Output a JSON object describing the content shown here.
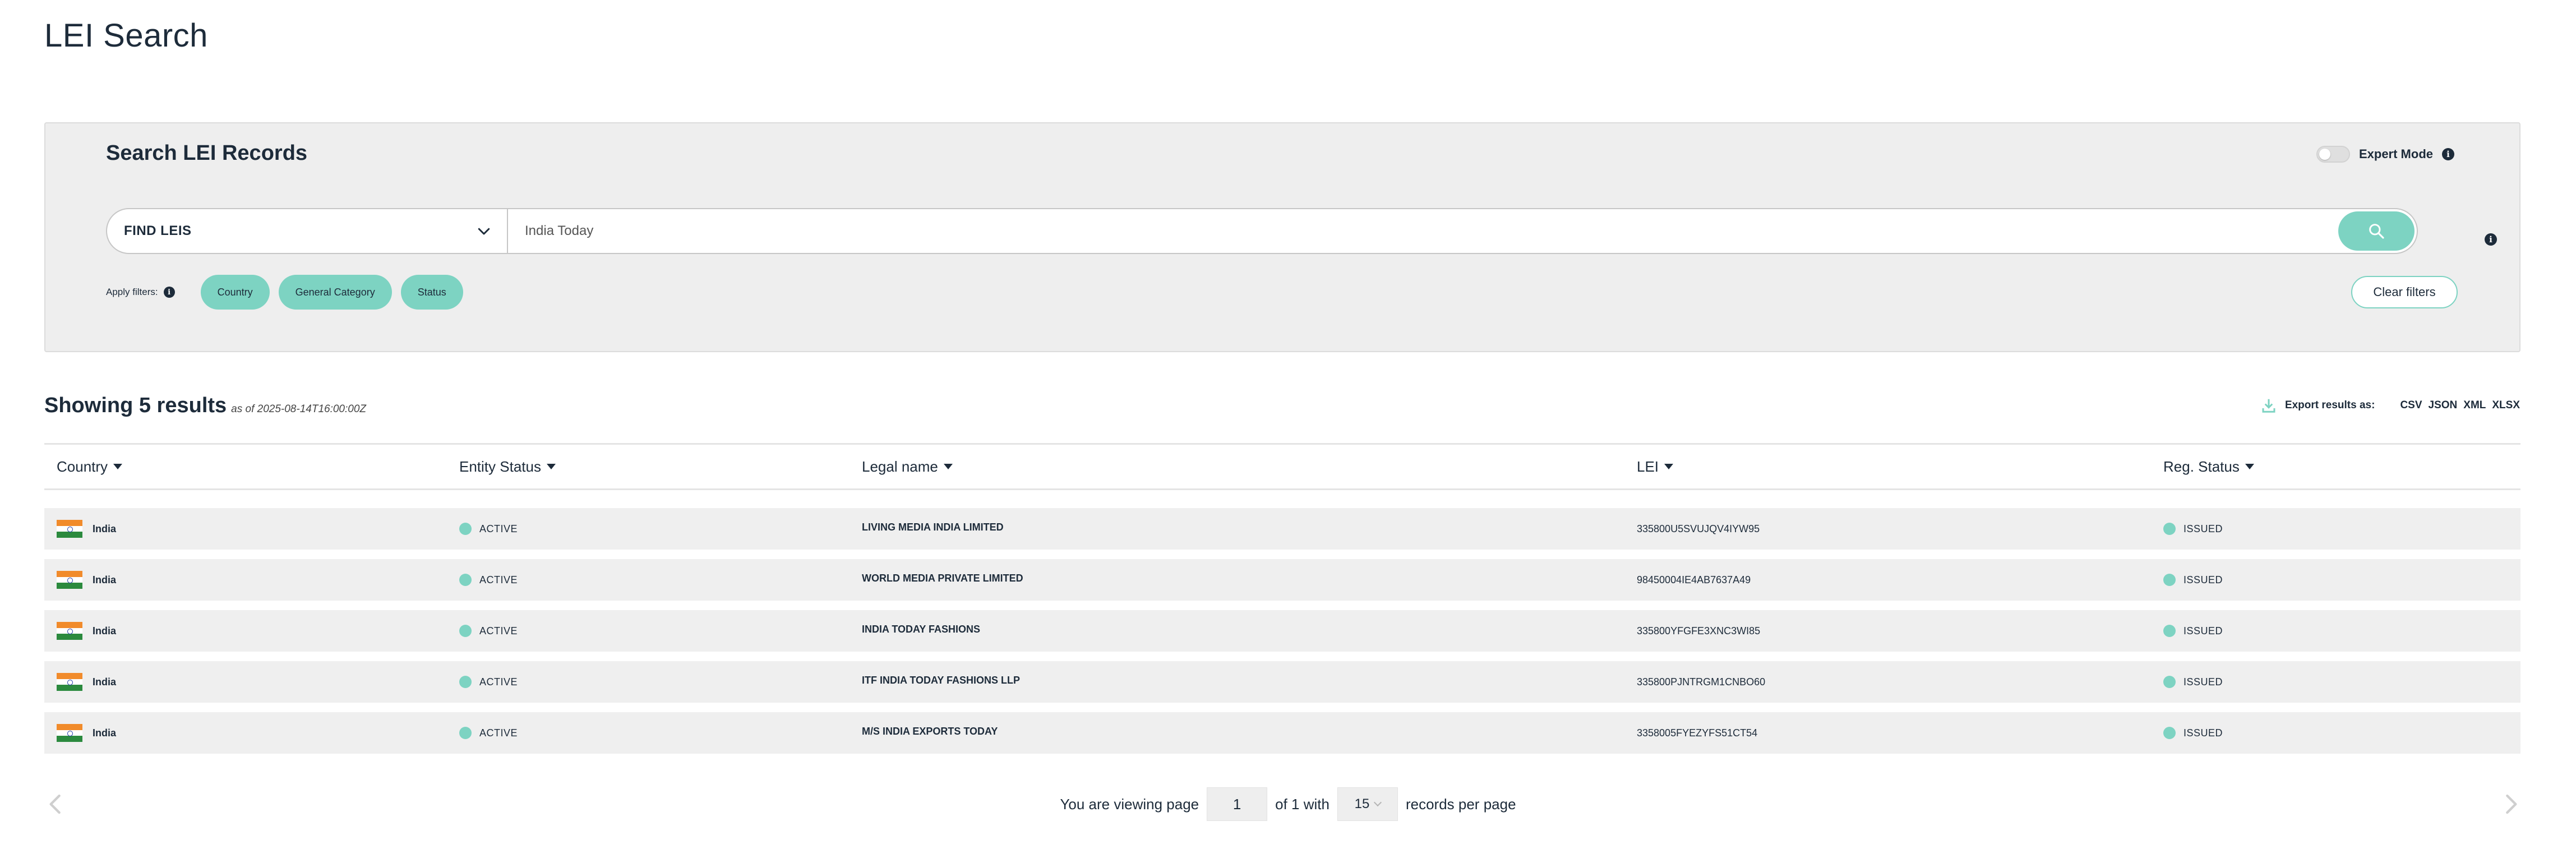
{
  "page": {
    "title": "LEI Search"
  },
  "search": {
    "heading": "Search LEI Records",
    "expert_mode_label": "Expert Mode",
    "type_label": "FIND LEIS",
    "query": "India Today",
    "filters_label": "Apply filters:",
    "filters": [
      "Country",
      "General Category",
      "Status"
    ],
    "clear_label": "Clear filters",
    "info_glyph": "i"
  },
  "results": {
    "count_label": "Showing 5 results",
    "as_of": "as of 2025-08-14T16:00:00Z",
    "export_label": "Export results as:",
    "export_formats": [
      "CSV",
      "JSON",
      "XML",
      "XLSX"
    ]
  },
  "table": {
    "columns": [
      "Country",
      "Entity Status",
      "Legal name",
      "LEI",
      "Reg. Status"
    ],
    "rows": [
      {
        "country": "India",
        "entity_status": "ACTIVE",
        "legal_name": "LIVING MEDIA INDIA LIMITED",
        "lei": "335800U5SVUJQV4IYW95",
        "reg_status": "ISSUED"
      },
      {
        "country": "India",
        "entity_status": "ACTIVE",
        "legal_name": "WORLD MEDIA PRIVATE LIMITED",
        "lei": "98450004IE4AB7637A49",
        "reg_status": "ISSUED"
      },
      {
        "country": "India",
        "entity_status": "ACTIVE",
        "legal_name": "INDIA TODAY FASHIONS",
        "lei": "335800YFGFE3XNC3WI85",
        "reg_status": "ISSUED"
      },
      {
        "country": "India",
        "entity_status": "ACTIVE",
        "legal_name": "ITF INDIA TODAY FASHIONS LLP",
        "lei": "335800PJNTRGM1CNBO60",
        "reg_status": "ISSUED"
      },
      {
        "country": "India",
        "entity_status": "ACTIVE",
        "legal_name": "M/S INDIA EXPORTS TODAY",
        "lei": "3358005FYEZYFS51CT54",
        "reg_status": "ISSUED"
      }
    ]
  },
  "pagination": {
    "viewing_label": "You are viewing page",
    "current_page": "1",
    "of_label": "of 1 with",
    "per_page": "15",
    "per_page_label": "records per page"
  },
  "colors": {
    "accent": "#7dd3c2",
    "text": "#1d2b3a",
    "panel": "#eeeeee",
    "row": "#efefef"
  },
  "icons": [
    "chevron-down-icon",
    "search-icon",
    "info-icon",
    "download-icon",
    "india-flag-icon",
    "chevron-left-icon",
    "chevron-right-icon"
  ]
}
